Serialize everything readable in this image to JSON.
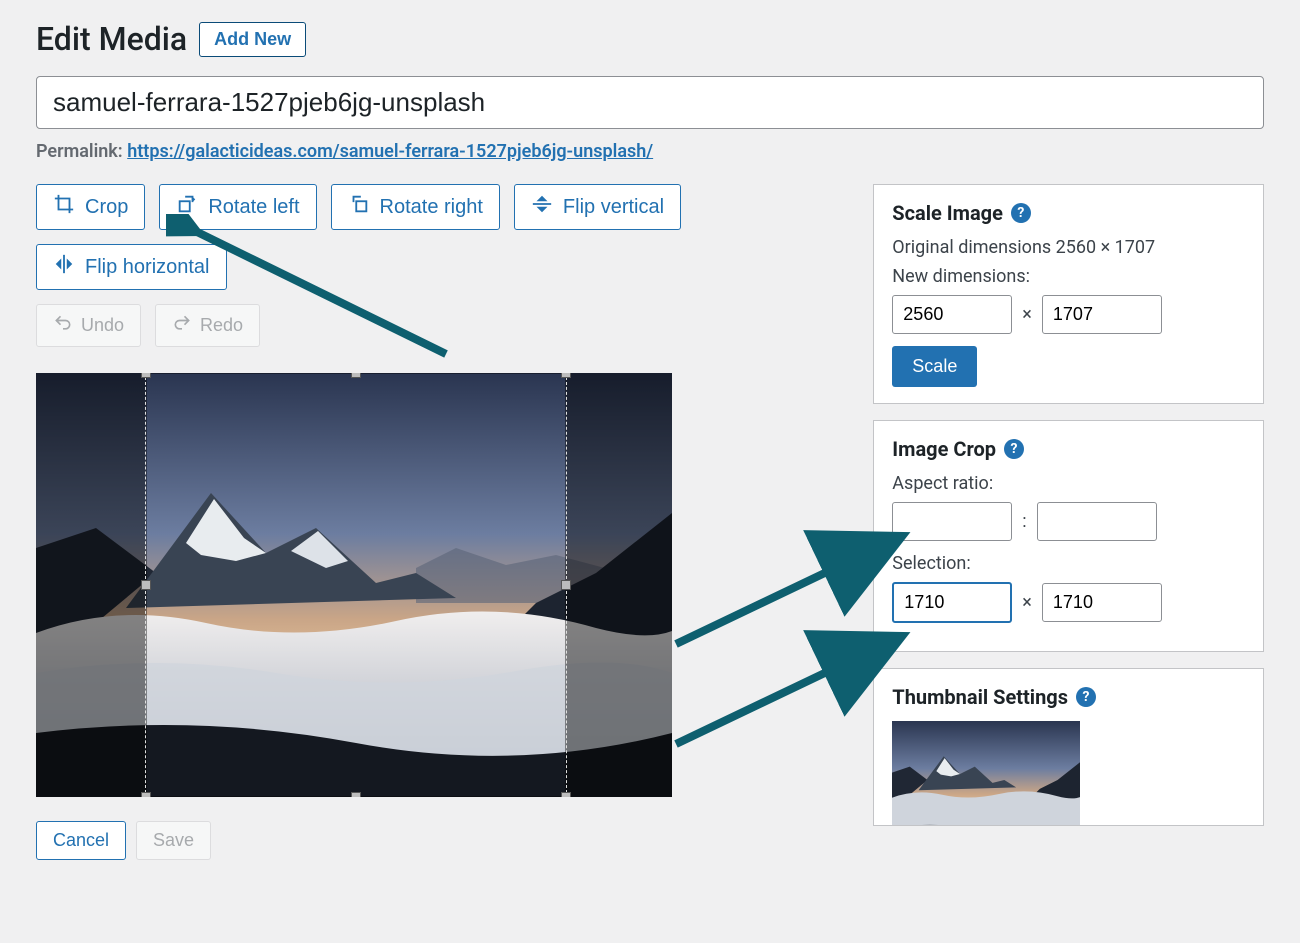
{
  "header": {
    "page_title": "Edit Media",
    "add_new_label": "Add New"
  },
  "title_input": {
    "value": "samuel-ferrara-1527pjeb6jg-unsplash"
  },
  "permalink": {
    "label": "Permalink:",
    "url_text": "https://galacticideas.com/samuel-ferrara-1527pjeb6jg-unsplash/"
  },
  "toolbar": {
    "crop": "Crop",
    "rotate_left": "Rotate left",
    "rotate_right": "Rotate right",
    "flip_vertical": "Flip vertical",
    "flip_horizontal": "Flip horizontal",
    "undo": "Undo",
    "redo": "Redo"
  },
  "bottom": {
    "cancel": "Cancel",
    "save": "Save"
  },
  "scale_panel": {
    "title": "Scale Image",
    "original_text": "Original dimensions 2560 × 1707",
    "new_dimensions_label": "New dimensions:",
    "width": "2560",
    "height": "1707",
    "times": "×",
    "scale_btn": "Scale"
  },
  "crop_panel": {
    "title": "Image Crop",
    "aspect_label": "Aspect ratio:",
    "aspect_w": "",
    "aspect_h": "",
    "aspect_sep": ":",
    "selection_label": "Selection:",
    "sel_w": "1710",
    "sel_h": "1710",
    "sel_sep": "×"
  },
  "thumb_panel": {
    "title": "Thumbnail Settings"
  }
}
